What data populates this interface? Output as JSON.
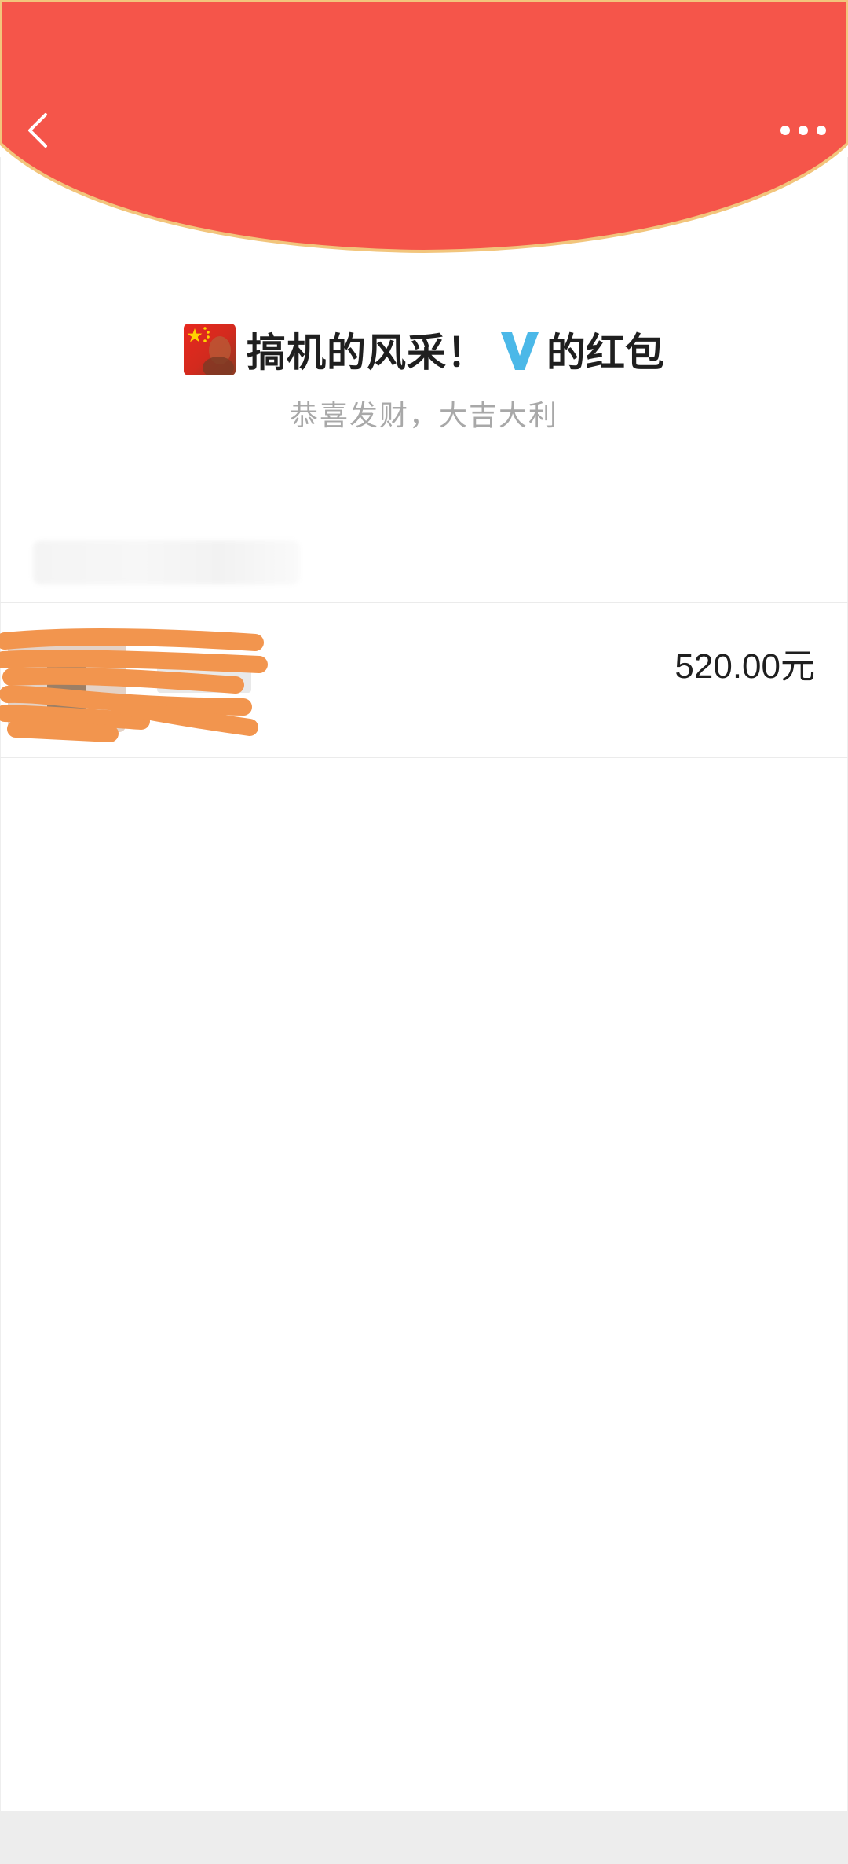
{
  "header": {
    "back_icon": "chevron-left-icon",
    "more_icon": "more-horizontal-icon",
    "colors": {
      "red": "#F5554A",
      "gold_edge": "#F2C57C"
    }
  },
  "sender": {
    "name": "搞机的风采！",
    "badge_icon": "verified-v-icon",
    "badge_color": "#4BB8E8",
    "suffix": "的红包",
    "avatar_icon": "china-flag-avatar"
  },
  "greeting": "恭喜发财，大吉大利",
  "receivers": [
    {
      "amount": "520.00元"
    }
  ]
}
